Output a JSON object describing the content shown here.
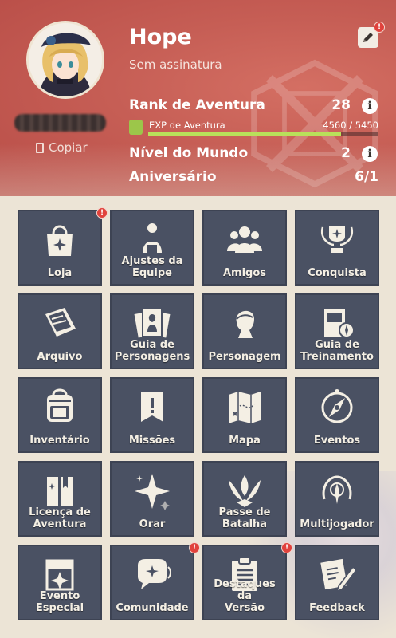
{
  "colors": {
    "header": "#c65e55",
    "tile": "#4a5163",
    "tile_text": "#f4efe4",
    "exp_fill": "#b9e15a",
    "badge": "#e0423c"
  },
  "profile": {
    "name": "Hope",
    "signature": "Sem assinatura",
    "copy_label": "Copiar",
    "edit_badge": "!",
    "adventure_rank_label": "Rank de Aventura",
    "adventure_rank": "28",
    "exp_label": "EXP de Aventura",
    "exp_value": "4560 / 5450",
    "exp_progress": 0.837,
    "world_level_label": "Nível do Mundo",
    "world_level": "2",
    "birthday_label": "Aniversário",
    "birthday": "6/1"
  },
  "menu": [
    {
      "label": "Loja",
      "icon": "shopping-bag-icon",
      "badge": "!"
    },
    {
      "label": "Ajustes da\nEquipe",
      "icon": "party-setup-icon",
      "badge": ""
    },
    {
      "label": "Amigos",
      "icon": "friends-icon",
      "badge": ""
    },
    {
      "label": "Conquista",
      "icon": "trophy-icon",
      "badge": ""
    },
    {
      "label": "Arquivo",
      "icon": "archive-book-icon",
      "badge": ""
    },
    {
      "label": "Guia de\nPersonagens",
      "icon": "character-cards-icon",
      "badge": ""
    },
    {
      "label": "Personagem",
      "icon": "character-silhouette-icon",
      "badge": ""
    },
    {
      "label": "Guia de\nTreinamento",
      "icon": "training-guide-icon",
      "badge": ""
    },
    {
      "label": "Inventário",
      "icon": "backpack-icon",
      "badge": ""
    },
    {
      "label": "Missões",
      "icon": "quest-banner-icon",
      "badge": ""
    },
    {
      "label": "Mapa",
      "icon": "map-icon",
      "badge": ""
    },
    {
      "label": "Eventos",
      "icon": "compass-icon",
      "badge": ""
    },
    {
      "label": "Licença de\nAventura",
      "icon": "license-book-icon",
      "badge": ""
    },
    {
      "label": "Orar",
      "icon": "wish-star-icon",
      "badge": ""
    },
    {
      "label": "Passe de\nBatalha",
      "icon": "battle-pass-icon",
      "badge": ""
    },
    {
      "label": "Multijogador",
      "icon": "co-op-icon",
      "badge": ""
    },
    {
      "label": "Evento\nEspecial",
      "icon": "special-event-icon",
      "badge": ""
    },
    {
      "label": "Comunidade",
      "icon": "chat-bubble-icon",
      "badge": "!"
    },
    {
      "label": "Destaques da\nVersão",
      "icon": "clipboard-icon",
      "badge": "!"
    },
    {
      "label": "Feedback",
      "icon": "feedback-pencil-icon",
      "badge": ""
    }
  ]
}
